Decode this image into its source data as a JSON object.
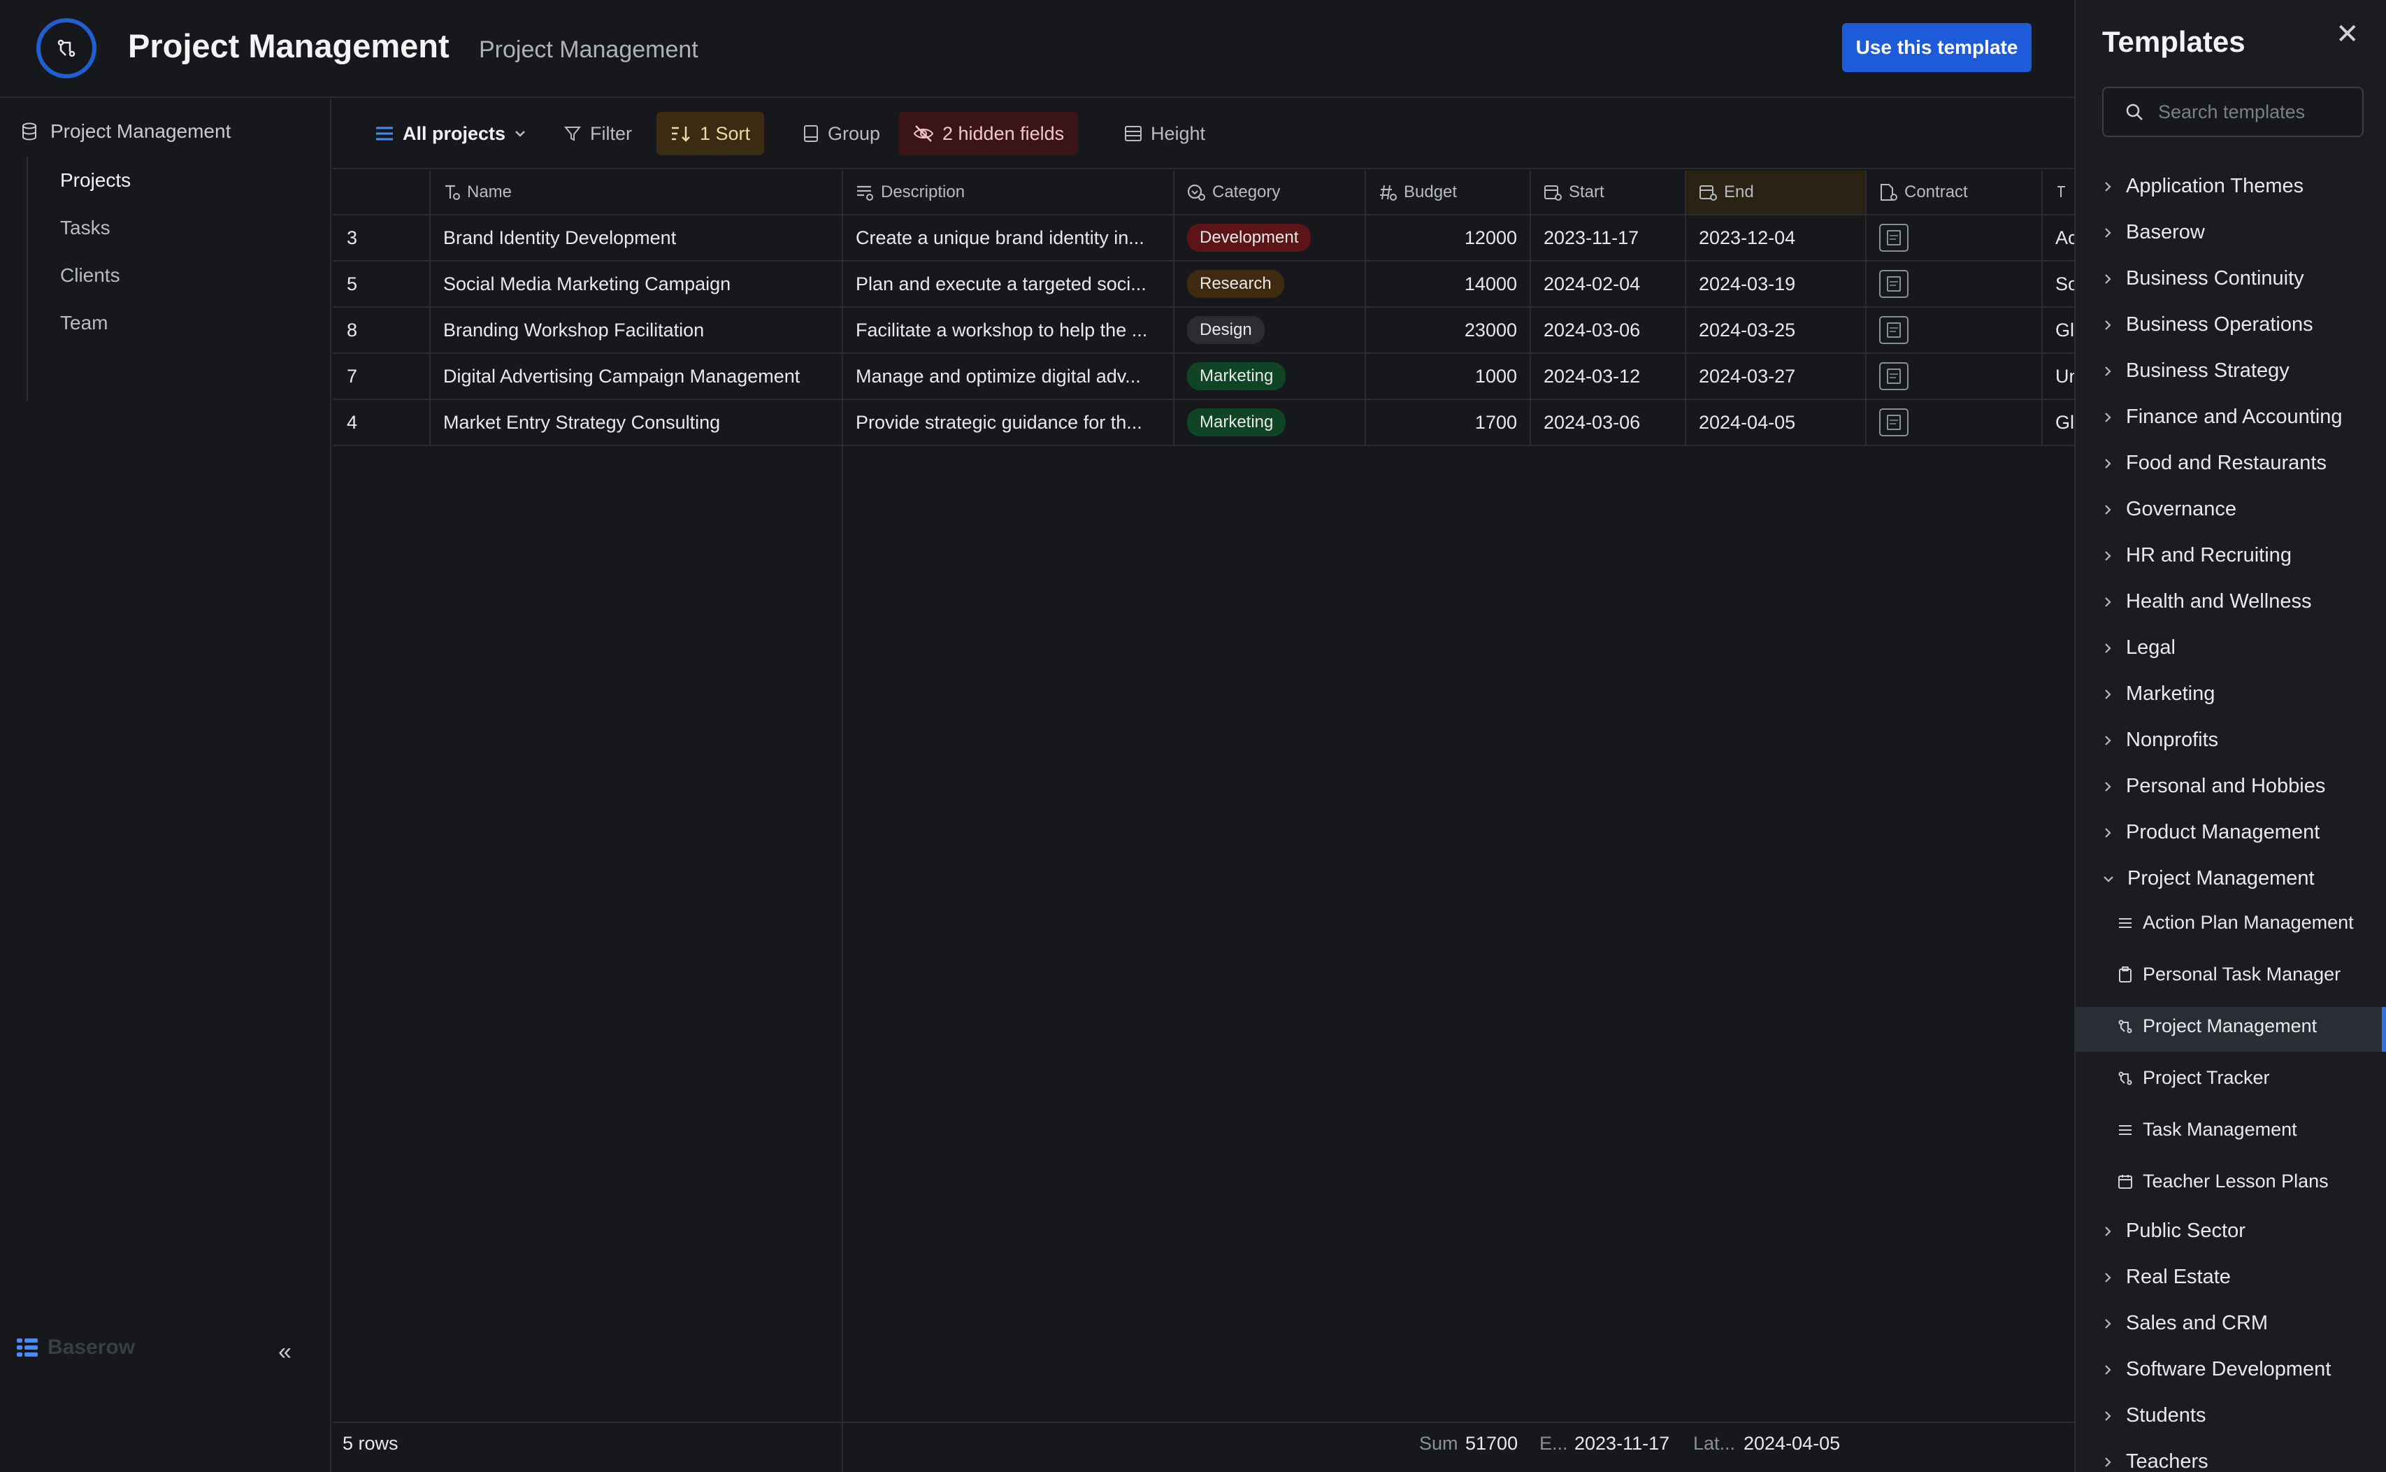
{
  "header": {
    "title": "Project Management",
    "subtitle": "Project Management",
    "use_template_label": "Use this template"
  },
  "sidebar": {
    "database": "Project Management",
    "items": [
      {
        "label": "Projects",
        "active": true
      },
      {
        "label": "Tasks"
      },
      {
        "label": "Clients"
      },
      {
        "label": "Team"
      }
    ],
    "brand": "Baserow"
  },
  "toolbar": {
    "view_label": "All projects",
    "filter_label": "Filter",
    "sort_label": "1 Sort",
    "group_label": "Group",
    "hidden_label": "2 hidden fields",
    "height_label": "Height"
  },
  "table": {
    "columns": [
      "Name",
      "Description",
      "Category",
      "Budget",
      "Start",
      "End",
      "Contract"
    ],
    "rows": [
      {
        "id": "3",
        "name": "Brand Identity Development",
        "description": "Create a unique brand identity in...",
        "category": "Development",
        "budget": "12000",
        "start": "2023-11-17",
        "end": "2023-12-04",
        "extra": "Ac"
      },
      {
        "id": "5",
        "name": "Social Media Marketing Campaign",
        "description": "Plan and execute a targeted soci...",
        "category": "Research",
        "budget": "14000",
        "start": "2024-02-04",
        "end": "2024-03-19",
        "extra": "So"
      },
      {
        "id": "8",
        "name": "Branding Workshop Facilitation",
        "description": "Facilitate a workshop to help the ...",
        "category": "Design",
        "budget": "23000",
        "start": "2024-03-06",
        "end": "2024-03-25",
        "extra": "Gl"
      },
      {
        "id": "7",
        "name": "Digital Advertising Campaign Management",
        "description": "Manage and optimize digital adv...",
        "category": "Marketing",
        "budget": "1000",
        "start": "2024-03-12",
        "end": "2024-03-27",
        "extra": "Un"
      },
      {
        "id": "4",
        "name": "Market Entry Strategy Consulting",
        "description": "Provide strategic guidance for th...",
        "category": "Marketing",
        "budget": "1700",
        "start": "2024-03-06",
        "end": "2024-04-05",
        "extra": "Gl"
      }
    ],
    "category_colors": {
      "Development": "#5c1416",
      "Research": "#3d2a10",
      "Design": "#2b2d33",
      "Marketing": "#0f4424"
    }
  },
  "footer": {
    "rows_label": "5 rows",
    "sum_label": "Sum",
    "sum_value": "51700",
    "earliest_label": "E...",
    "earliest_value": "2023-11-17",
    "latest_label": "Lat...",
    "latest_value": "2024-04-05"
  },
  "templates": {
    "title": "Templates",
    "search_placeholder": "Search templates",
    "categories_top": [
      "Application Themes",
      "Baserow",
      "Business Continuity",
      "Business Operations",
      "Business Strategy",
      "Finance and Accounting",
      "Food and Restaurants",
      "Governance",
      "HR and Recruiting",
      "Health and Wellness",
      "Legal",
      "Marketing",
      "Nonprofits",
      "Personal and Hobbies",
      "Product Management"
    ],
    "expanded": "Project Management",
    "sub_items": [
      "Action Plan Management",
      "Personal Task Manager",
      "Project Management",
      "Project Tracker",
      "Task Management",
      "Teacher Lesson Plans"
    ],
    "categories_bottom": [
      "Public Sector",
      "Real Estate",
      "Sales and CRM",
      "Software Development",
      "Students",
      "Teachers"
    ]
  },
  "colors": {
    "accent": "#1e5bd8",
    "background": "#17181b"
  }
}
